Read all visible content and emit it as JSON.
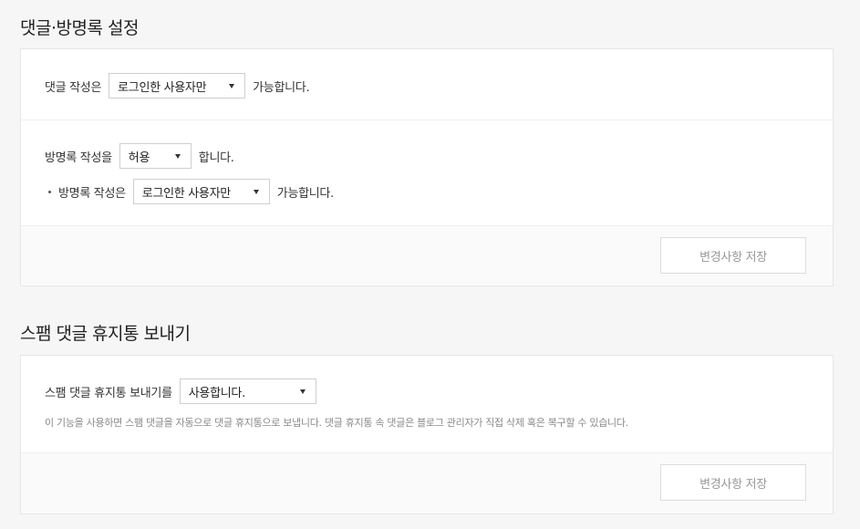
{
  "comment_settings": {
    "title": "댓글·방명록 설정",
    "comment_prefix": "댓글 작성은",
    "comment_select": "로그인한 사용자만",
    "comment_suffix": "가능합니다.",
    "guestbook_prefix": "방명록 작성을",
    "guestbook_select": "허용",
    "guestbook_suffix": "합니다.",
    "guestbook_write_prefix": "방명록 작성은",
    "guestbook_write_select": "로그인한 사용자만",
    "guestbook_write_suffix": "가능합니다.",
    "save_label": "변경사항 저장"
  },
  "spam_settings": {
    "title": "스팸 댓글 휴지통 보내기",
    "prefix": "스팸 댓글 휴지통 보내기를",
    "select": "사용합니다.",
    "description": "이 기능을 사용하면 스팸 댓글을 자동으로 댓글 휴지통으로 보냅니다. 댓글 휴지통 속 댓글은 블로그 관리자가 직접 삭제 혹은 복구할 수 있습니다.",
    "save_label": "변경사항 저장"
  }
}
